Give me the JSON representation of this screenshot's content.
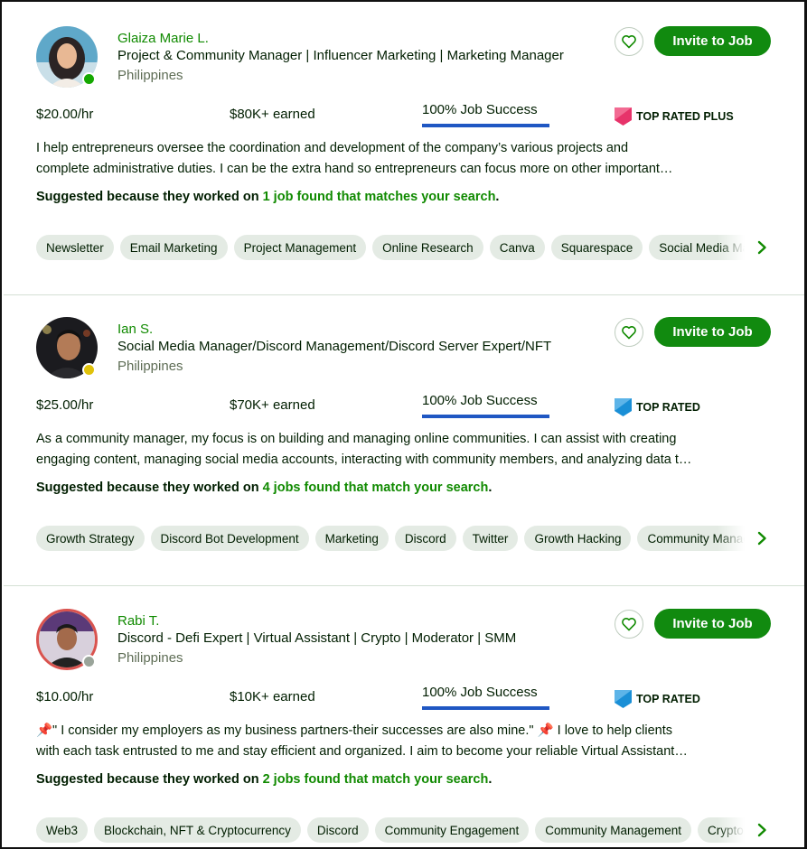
{
  "cards": [
    {
      "name": "Glaiza Marie L.",
      "headline": "Project & Community Manager | Influencer Marketing | Marketing Manager",
      "location": "Philippines",
      "status_color": "#14a800",
      "invite_label": "Invite to Job",
      "rate": "$20.00/hr",
      "earned": "$80K+ earned",
      "job_success": "100% Job Success",
      "badge": "TOP RATED PLUS",
      "badge_color": "#e7336a",
      "description_lines": [
        "I help entrepreneurs oversee the coordination and development of the company’s various projects and",
        "complete administrative duties. I can be the extra hand so entrepreneurs can focus more on other important…"
      ],
      "suggest_prefix": "Suggested because they worked on ",
      "suggest_link": "1 job found that matches your search",
      "suggest_suffix": ".",
      "skills": [
        "Newsletter",
        "Email Marketing",
        "Project Management",
        "Online Research",
        "Canva",
        "Squarespace",
        "Social Media Marketing"
      ]
    },
    {
      "name": "Ian S.",
      "headline": "Social Media Manager/Discord Management/Discord Server Expert/NFT",
      "location": "Philippines",
      "status_color": "#e0c20a",
      "invite_label": "Invite to Job",
      "rate": "$25.00/hr",
      "earned": "$70K+ earned",
      "job_success": "100% Job Success",
      "badge": "TOP RATED",
      "badge_color": "#1a8fd6",
      "description_lines": [
        "As a community manager, my focus is on building and managing online communities. I can assist with creating",
        "engaging content, managing social media accounts, interacting with community members, and analyzing data t…"
      ],
      "suggest_prefix": "Suggested because they worked on ",
      "suggest_link": "4 jobs found that match your search",
      "suggest_suffix": ".",
      "skills": [
        "Growth Strategy",
        "Discord Bot Development",
        "Marketing",
        "Discord",
        "Twitter",
        "Growth Hacking",
        "Community Management"
      ]
    },
    {
      "name": "Rabi T.",
      "headline": "Discord - Defi Expert | Virtual Assistant | Crypto | Moderator | SMM",
      "location": "Philippines",
      "status_color": "#9aa49a",
      "invite_label": "Invite to Job",
      "rate": "$10.00/hr",
      "earned": "$10K+ earned",
      "job_success": "100% Job Success",
      "badge": "TOP RATED",
      "badge_color": "#1a8fd6",
      "description_lines": [
        "📌\" I consider my employers as my business partners-their successes are also mine.\" 📌 I love to help clients",
        "with each task entrusted to me and stay efficient and organized. I aim to become your reliable Virtual Assistant…"
      ],
      "suggest_prefix": "Suggested because they worked on ",
      "suggest_link": "2 jobs found that match your search",
      "suggest_suffix": ".",
      "skills": [
        "Web3",
        "Blockchain, NFT & Cryptocurrency",
        "Discord",
        "Community Engagement",
        "Community Management",
        "Cryptocurrency"
      ]
    }
  ],
  "icons": {
    "favorite": "heart-outline-icon",
    "next": "chevron-right-icon",
    "badge": "badge-icon"
  },
  "colors": {
    "accent_green": "#108a00",
    "button_green": "#118a0f",
    "job_success_bar": "#1f57c3",
    "chip_bg": "#e4ebe4"
  }
}
